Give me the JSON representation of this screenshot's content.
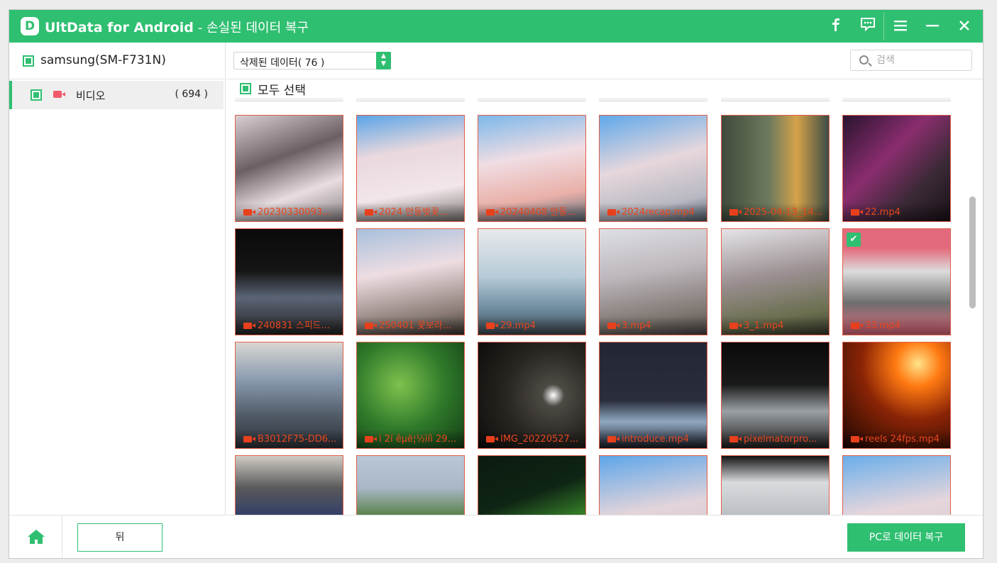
{
  "app": {
    "name": "UltData for Android",
    "subtitle": "- 손실된 데이터 복구",
    "logo_letter": "D"
  },
  "titlebar_icons": [
    "facebook-icon",
    "feedback-icon",
    "menu-icon",
    "minimize-icon",
    "close-icon"
  ],
  "sidebar": {
    "device": "samsung(SM-F731N)",
    "categories": [
      {
        "label": "비디오",
        "count": "( 694 )"
      }
    ]
  },
  "toolbar": {
    "filter_value": "삭제된 데이터( 76 )",
    "search_placeholder": "검색",
    "select_all": "모두 선택"
  },
  "tiles": [
    {
      "name": "20230330093...",
      "checked": false
    },
    {
      "name": "2024 안동벚꽃...",
      "checked": false
    },
    {
      "name": "20240408 안동...",
      "checked": false
    },
    {
      "name": "2024recap.mp4",
      "checked": false
    },
    {
      "name": "2025-04-13_14...",
      "checked": false
    },
    {
      "name": "22.mp4",
      "checked": false
    },
    {
      "name": "240831 스피드...",
      "checked": false
    },
    {
      "name": "250401 꽃보라...",
      "checked": false
    },
    {
      "name": "29.mp4",
      "checked": false
    },
    {
      "name": "3.mp4",
      "checked": false
    },
    {
      "name": "3_1.mp4",
      "checked": false
    },
    {
      "name": "33.mp4",
      "checked": true
    },
    {
      "name": "B3012F75-DD6...",
      "checked": false
    },
    {
      "name": "ì 2í êµë¦½ìíì 29...",
      "checked": false
    },
    {
      "name": "IMG_20220527...",
      "checked": false
    },
    {
      "name": "introduce.mp4",
      "checked": false
    },
    {
      "name": "pixelmatorpro...",
      "checked": false
    },
    {
      "name": "reels 24fps.mp4",
      "checked": false
    },
    {
      "name": "",
      "checked": false
    },
    {
      "name": "",
      "checked": false
    },
    {
      "name": "",
      "checked": false
    },
    {
      "name": "",
      "checked": false
    },
    {
      "name": "",
      "checked": false
    },
    {
      "name": "",
      "checked": false
    }
  ],
  "footer": {
    "back_label": "뒤",
    "recover_label": "PC로 데이터 복구"
  },
  "colors": {
    "accent": "#2fbf71",
    "tile_border": "#e0604a",
    "filename": "#e8461f"
  }
}
